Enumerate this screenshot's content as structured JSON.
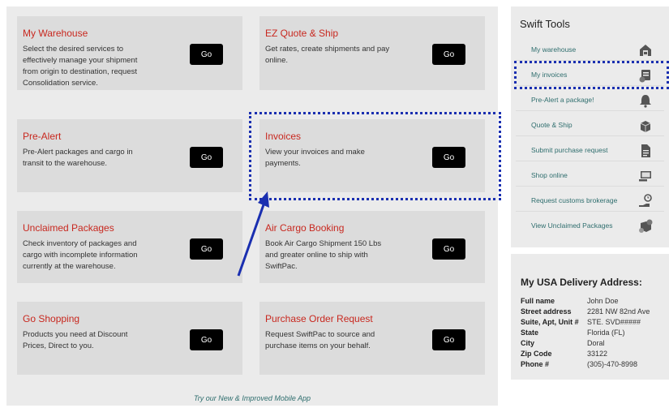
{
  "cards": [
    {
      "title": "My Warehouse",
      "desc": "Select the desired services to effectively manage your shipment from origin to destination, request Consolidation service.",
      "button": "Go"
    },
    {
      "title": "EZ Quote & Ship",
      "desc": "Get rates, create shipments and pay online.",
      "button": "Go"
    },
    {
      "title": "Pre-Alert",
      "desc": "Pre-Alert packages and cargo in transit to the warehouse.",
      "button": "Go"
    },
    {
      "title": "Invoices",
      "desc": "View your invoices and make payments.",
      "button": "Go"
    },
    {
      "title": "Unclaimed Packages",
      "desc": "Check inventory of packages and cargo with incomplete information currently at the warehouse.",
      "button": "Go"
    },
    {
      "title": "Air Cargo Booking",
      "desc": "Book Air Cargo Shipment 150 Lbs and greater online to ship with SwiftPac.",
      "button": "Go"
    },
    {
      "title": "Go Shopping",
      "desc": "Products you need at Discount Prices, Direct to you.",
      "button": "Go"
    },
    {
      "title": "Purchase Order Request",
      "desc": "Request SwiftPac to source and purchase items on your behalf.",
      "button": "Go"
    }
  ],
  "mobile_link": "Try our New & Improved Mobile App",
  "swift_tools": {
    "title": "Swift Tools",
    "items": [
      {
        "label": "My warehouse",
        "icon": "warehouse-icon"
      },
      {
        "label": "My invoices",
        "icon": "invoice-icon"
      },
      {
        "label": "Pre-Alert a package!",
        "icon": "alert-bell-icon"
      },
      {
        "label": "Quote & Ship",
        "icon": "quote-box-icon"
      },
      {
        "label": "Submit purchase request",
        "icon": "document-icon"
      },
      {
        "label": "Shop online",
        "icon": "shop-monitor-icon"
      },
      {
        "label": "Request customs brokerage",
        "icon": "customs-icon"
      },
      {
        "label": "View Unclaimed Packages",
        "icon": "unclaimed-package-icon"
      }
    ]
  },
  "address": {
    "title": "My USA Delivery Address:",
    "rows": [
      {
        "k": "Full name",
        "v": "John Doe"
      },
      {
        "k": "Street address",
        "v": "2281 NW 82nd Ave"
      },
      {
        "k": "Suite, Apt, Unit #",
        "v": "STE. SVD#####"
      },
      {
        "k": "State",
        "v": "Florida (FL)"
      },
      {
        "k": "City",
        "v": "Doral"
      },
      {
        "k": "Zip Code",
        "v": "33122"
      },
      {
        "k": "Phone #",
        "v": "(305)-470-8998"
      }
    ]
  },
  "colors": {
    "accent": "#c8281f",
    "link": "#2f6e6e",
    "highlight": "#1a2fb0"
  }
}
